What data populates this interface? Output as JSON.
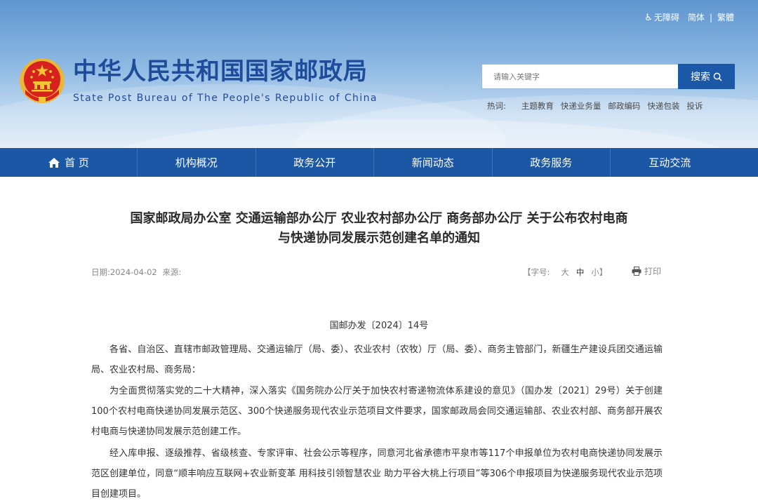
{
  "top_links": {
    "accessibility": "无障碍",
    "simplified": "简体",
    "separator": "|",
    "traditional": "繁體"
  },
  "site": {
    "title_cn": "中华人民共和国国家邮政局",
    "title_en": "State Post Bureau of The People's Republic of China"
  },
  "search": {
    "placeholder": "请输入关键字",
    "button": "搜索"
  },
  "hotwords": {
    "label": "热词:",
    "items": [
      "主题教育",
      "快递业务量",
      "邮政编码",
      "快递包装",
      "投诉"
    ]
  },
  "nav": {
    "items": [
      "首 页",
      "机构概况",
      "政务公开",
      "新闻动态",
      "政务服务",
      "互动交流"
    ]
  },
  "article": {
    "title_line1": "国家邮政局办公室 交通运输部办公厅 农业农村部办公厅 商务部办公厅 关于公布农村电商",
    "title_line2": "与快递协同发展示范创建名单的通知",
    "date_label": "日期:",
    "date": "2024-04-02",
    "source_label": "来源:",
    "fontsize_label": "【字号:",
    "fontsize_large": "大",
    "fontsize_medium": "中",
    "fontsize_small": "小】",
    "print": "打印",
    "doc_number": "国邮办发〔2024〕14号",
    "paragraphs": [
      "各省、自治区、直辖市邮政管理局、交通运输厅（局、委）、农业农村（农牧）厅（局、委）、商务主管部门，新疆生产建设兵团交通运输局、农业农村局、商务局：",
      "为全面贯彻落实党的二十大精神，深入落实《国务院办公厅关于加快农村寄递物流体系建设的意见》（国办发〔2021〕29号）关于创建100个农村电商快递协同发展示范区、300个快递服务现代农业示范项目文件要求，国家邮政局会同交通运输部、农业农村部、商务部开展农村电商与快递协同发展示范创建工作。",
      "经入库申报、逐级推荐、省级核查、专家评审、社会公示等程序，同意河北省承德市平泉市等117个申报单位为农村电商快递协同发展示范区创建单位，同意“顺丰响应互联网+农业新变革 用科技引领智慧农业 助力平谷大桃上行项目”等306个申报项目为快递服务现代农业示范项目创建项目。"
    ]
  },
  "colors": {
    "brand_blue": "#1c57a6",
    "title_blue": "#1e4c9a",
    "emblem_red": "#d8201e",
    "emblem_gold": "#f3c534"
  }
}
